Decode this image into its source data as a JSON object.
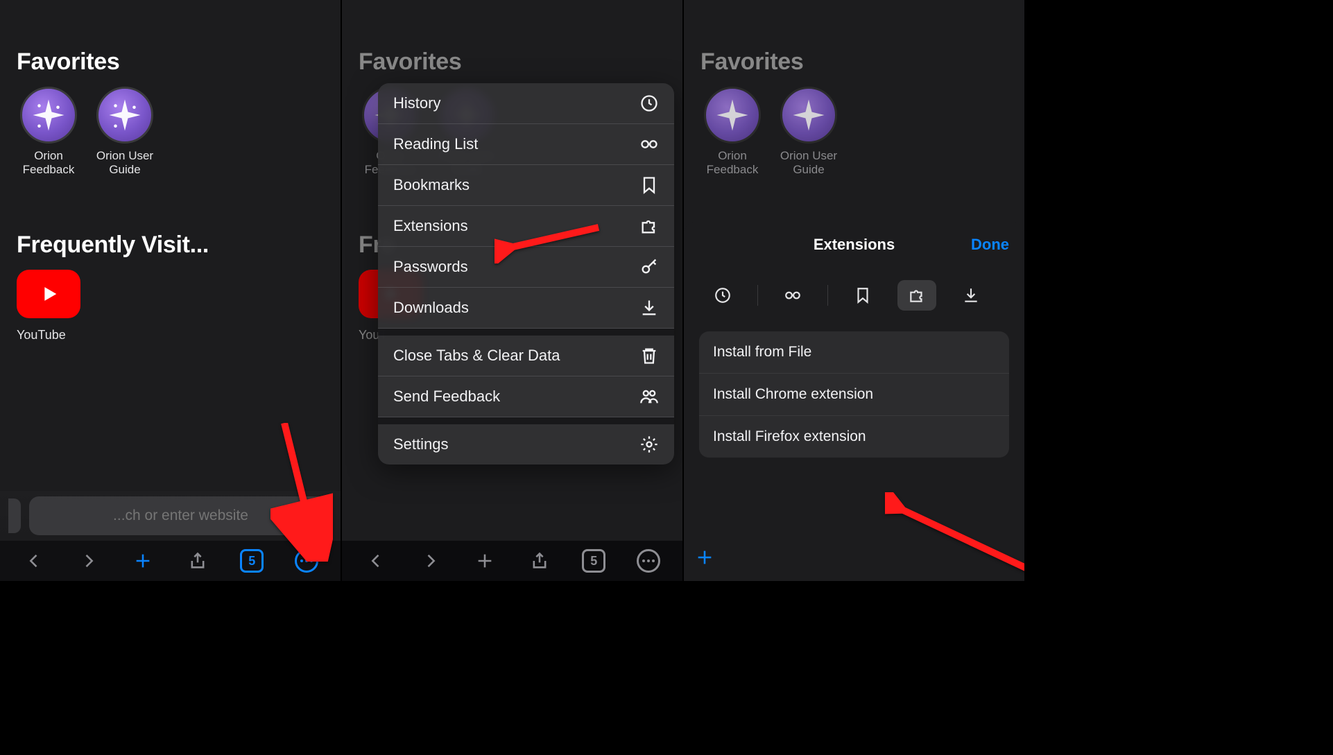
{
  "screen1": {
    "favorites_title": "Favorites",
    "fav_items": [
      {
        "label": "Orion Feedback"
      },
      {
        "label": "Orion User Guide"
      }
    ],
    "freq_title": "Frequently Visit...",
    "freq_item_label": "YouTube",
    "address_placeholder": "...ch or enter website",
    "tabs_count": "5"
  },
  "screen2": {
    "favorites_title": "Favorites",
    "fav_items": [
      {
        "label": "Orion Feedback"
      },
      {
        "label": "Orion User Guide"
      }
    ],
    "freq_title": "Fre",
    "freq_item_label": "YouT",
    "menu": [
      {
        "label": "History",
        "icon": "clock"
      },
      {
        "label": "Reading List",
        "icon": "glasses"
      },
      {
        "label": "Bookmarks",
        "icon": "bookmark"
      },
      {
        "label": "Extensions",
        "icon": "puzzle"
      },
      {
        "label": "Passwords",
        "icon": "key"
      },
      {
        "label": "Downloads",
        "icon": "download"
      },
      {
        "label": "Close Tabs & Clear Data",
        "icon": "trash",
        "gap": true
      },
      {
        "label": "Send Feedback",
        "icon": "people"
      },
      {
        "label": "Settings",
        "icon": "gear",
        "gap": true
      }
    ],
    "tabs_count": "5"
  },
  "screen3": {
    "favorites_title": "Favorites",
    "fav_items": [
      {
        "label": "Orion Feedback"
      },
      {
        "label": "Orion User Guide"
      }
    ],
    "sheet_title": "Extensions",
    "done_label": "Done",
    "iconbar": [
      {
        "icon": "clock",
        "active": false
      },
      {
        "icon": "glasses",
        "active": false
      },
      {
        "icon": "bookmark",
        "active": false
      },
      {
        "icon": "puzzle",
        "active": true
      },
      {
        "icon": "download",
        "active": false
      }
    ],
    "install_options": [
      "Install from File",
      "Install Chrome extension",
      "Install Firefox extension"
    ]
  }
}
